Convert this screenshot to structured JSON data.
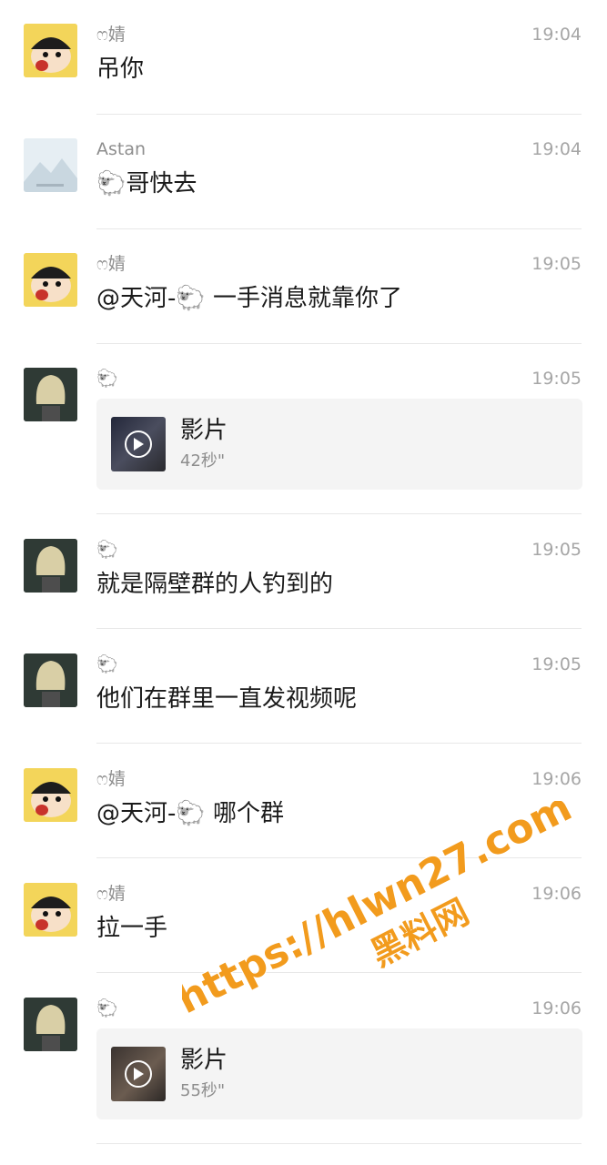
{
  "icons": {
    "avatar_shin": "shin-chan-avatar-icon",
    "avatar_astan": "landscape-avatar-icon",
    "avatar_sheep": "blonde-hair-avatar-icon",
    "play": "play-icon",
    "sheep_emoji": "sheep-emoji"
  },
  "colors": {
    "text": "#1b1b1b",
    "name": "#8e8e8e",
    "time": "#a6a6a6",
    "card": "#f4f4f4",
    "watermark": "#f29b1d"
  },
  "sheep": "🐑",
  "messages": [
    {
      "avatar": "shin",
      "name": "ෆ婧",
      "time": "19:04",
      "text": "吊你"
    },
    {
      "avatar": "astan",
      "name": "Astan",
      "time": "19:04",
      "text": "哥快去"
    },
    {
      "avatar": "shin",
      "name": "ෆ婧",
      "time": "19:05",
      "text_pre": "@天河-",
      "text_post": " 一手消息就靠你了"
    },
    {
      "avatar": "sheep",
      "name": "",
      "time": "19:05",
      "video": {
        "title": "影片",
        "duration": "42秒\""
      }
    },
    {
      "avatar": "sheep",
      "name": "",
      "time": "19:05",
      "text": "就是隔壁群的人钓到的"
    },
    {
      "avatar": "sheep",
      "name": "",
      "time": "19:05",
      "text": "他们在群里一直发视频呢"
    },
    {
      "avatar": "shin",
      "name": "ෆ婧",
      "time": "19:06",
      "text_pre": "@天河-",
      "text_post": " 哪个群"
    },
    {
      "avatar": "shin",
      "name": "ෆ婧",
      "time": "19:06",
      "text": "拉一手"
    },
    {
      "avatar": "sheep",
      "name": "",
      "time": "19:06",
      "video": {
        "title": "影片",
        "duration": "55秒\""
      }
    }
  ],
  "watermark": {
    "line1": "https://hlwn27.com",
    "line2": "黑料网"
  }
}
